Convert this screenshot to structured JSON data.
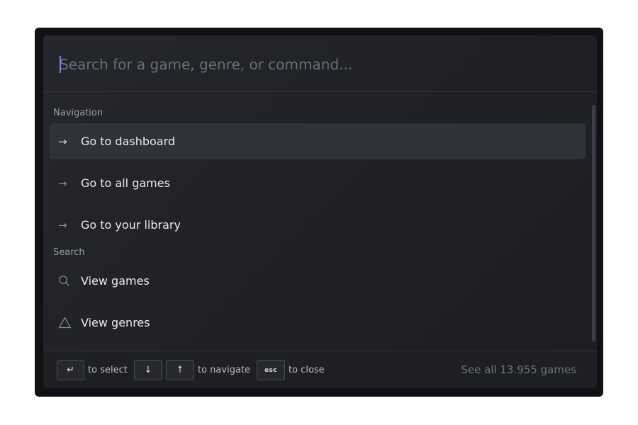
{
  "search": {
    "placeholder": "Search for a game, genre, or command...",
    "value": ""
  },
  "groups": {
    "navigation": {
      "heading": "Navigation",
      "items": [
        {
          "label": "Go to dashboard",
          "icon": "arrow-right-icon",
          "active": true
        },
        {
          "label": "Go to all games",
          "icon": "arrow-right-icon",
          "active": false
        },
        {
          "label": "Go to your library",
          "icon": "arrow-right-icon",
          "active": false
        }
      ]
    },
    "search": {
      "heading": "Search",
      "items": [
        {
          "label": "View games",
          "icon": "search-icon",
          "active": false
        },
        {
          "label": "View genres",
          "icon": "triangle-icon",
          "active": false
        }
      ]
    }
  },
  "footer": {
    "select_key": "↵",
    "select_hint": "to select",
    "down_key": "↓",
    "up_key": "↑",
    "navigate_hint": "to navigate",
    "esc_key": "esc",
    "close_hint": "to close",
    "see_all": "See all 13.955 games"
  },
  "colors": {
    "background": "#1e2025",
    "active_item": "#2f323a",
    "caret": "#8a7fe0",
    "muted_text": "#6f727a"
  }
}
